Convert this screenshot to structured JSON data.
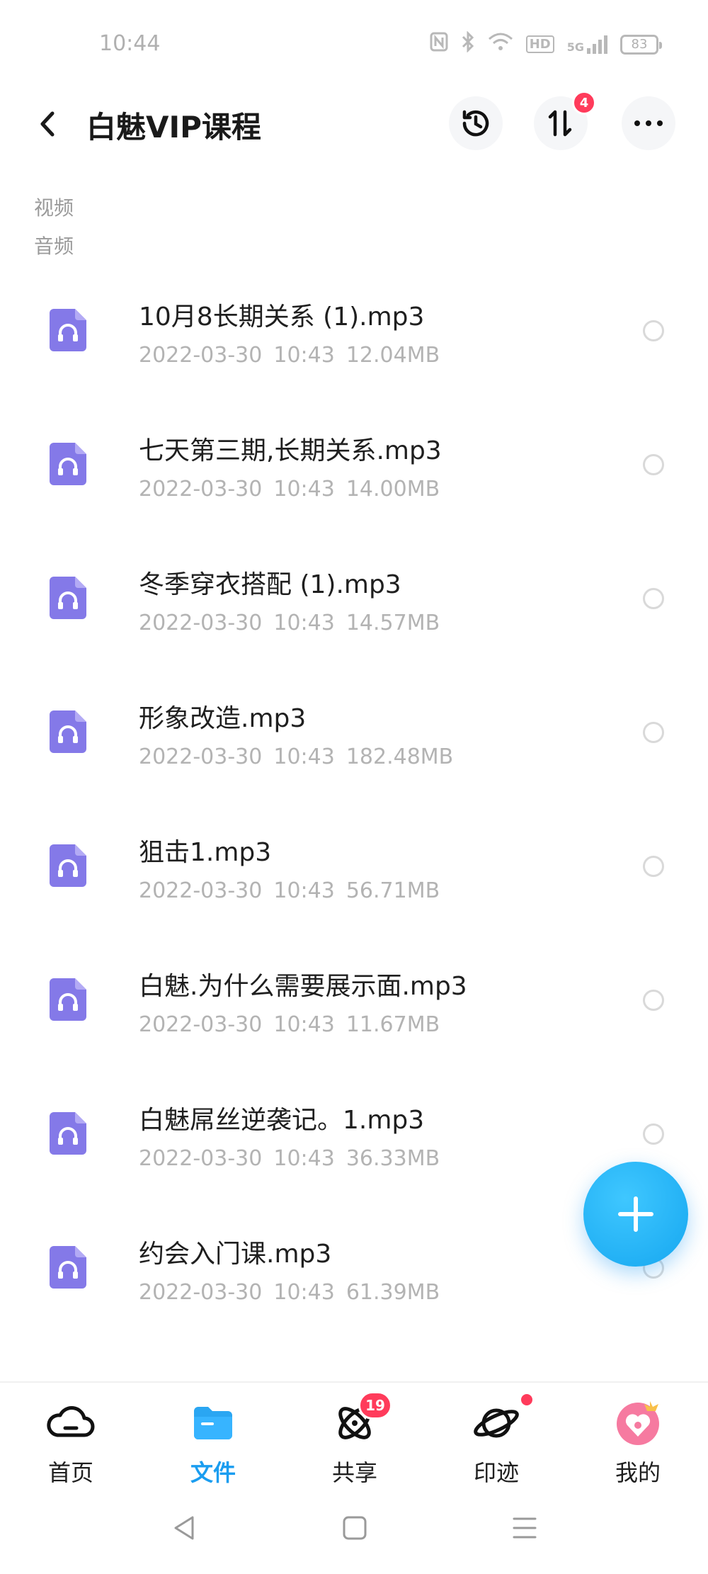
{
  "status_bar": {
    "time": "10:44",
    "network": "5G",
    "hd": "HD",
    "battery": "83"
  },
  "header": {
    "title": "白魅VIP课程",
    "transfer_badge": "4"
  },
  "filters": {
    "video": "视频",
    "audio": "音频"
  },
  "files": [
    {
      "name": "10月8长期关系 (1).mp3",
      "date": "2022-03-30",
      "time": "10:43",
      "size": "12.04MB"
    },
    {
      "name": "七天第三期,长期关系.mp3",
      "date": "2022-03-30",
      "time": "10:43",
      "size": "14.00MB"
    },
    {
      "name": "冬季穿衣搭配 (1).mp3",
      "date": "2022-03-30",
      "time": "10:43",
      "size": "14.57MB"
    },
    {
      "name": "形象改造.mp3",
      "date": "2022-03-30",
      "time": "10:43",
      "size": "182.48MB"
    },
    {
      "name": "狙击1.mp3",
      "date": "2022-03-30",
      "time": "10:43",
      "size": "56.71MB"
    },
    {
      "name": "白魅.为什么需要展示面.mp3",
      "date": "2022-03-30",
      "time": "10:43",
      "size": "11.67MB"
    },
    {
      "name": "白魅屌丝逆袭记。1.mp3",
      "date": "2022-03-30",
      "time": "10:43",
      "size": "36.33MB"
    },
    {
      "name": "约会入门课.mp3",
      "date": "2022-03-30",
      "time": "10:43",
      "size": "61.39MB"
    }
  ],
  "tabs": [
    {
      "label": "首页",
      "icon": "cloud-icon"
    },
    {
      "label": "文件",
      "icon": "folder-icon"
    },
    {
      "label": "共享",
      "icon": "atom-icon",
      "badge": "19"
    },
    {
      "label": "印迹",
      "icon": "planet-icon"
    },
    {
      "label": "我的",
      "icon": "avatar-icon"
    }
  ],
  "colors": {
    "accent": "#1a9df0",
    "badge": "#ff3b5b",
    "file_icon": "#8479e8"
  }
}
